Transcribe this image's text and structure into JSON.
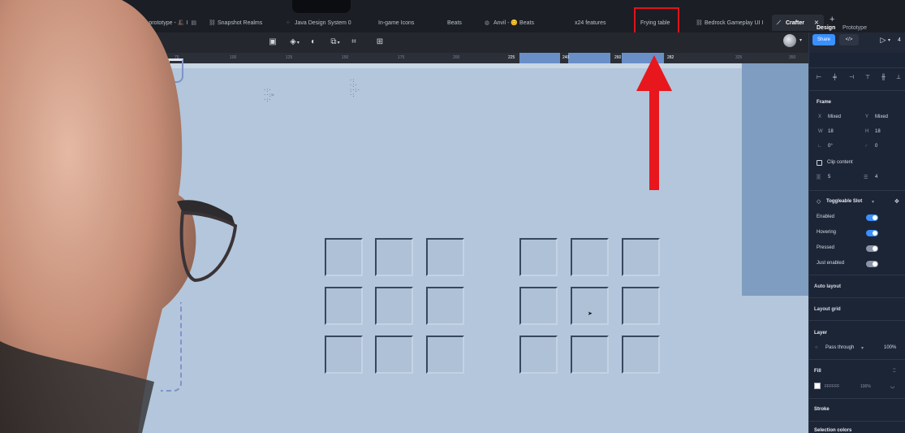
{
  "tabs": [
    {
      "label": "y5 prototype - 🎩 I",
      "icon": "file-icon"
    },
    {
      "label": "Snapshot Realms",
      "icon": "link-icon"
    },
    {
      "label": "Java Design System 0",
      "icon": "component-icon"
    },
    {
      "label": "In-game Icons",
      "icon": "file-icon"
    },
    {
      "label": "Beats",
      "icon": "file-icon"
    },
    {
      "label": "Anvil - 😊 Beats",
      "icon": "file-icon"
    },
    {
      "label": "x24 features",
      "icon": "file-icon"
    },
    {
      "label": "Frying table",
      "icon": "file-icon"
    },
    {
      "label": "Bedrock Gameplay UI I",
      "icon": "link-icon"
    },
    {
      "label": "Crafter",
      "icon": "figma-icon",
      "active": true
    }
  ],
  "ruler_labels": [
    "75",
    "100",
    "125",
    "150",
    "175",
    "200",
    "225",
    "240",
    "260",
    "282",
    "325",
    "350"
  ],
  "toolbar": {
    "share_label": "Share",
    "code_label": "</>",
    "play_label": "▷",
    "more_label": "4"
  },
  "panel": {
    "tabs": [
      "Design",
      "Prototype"
    ],
    "frame_label": "Frame",
    "x_label": "X",
    "x_value": "Mixed",
    "y_label": "Y",
    "y_value": "Mixed",
    "w_label": "W",
    "w_value": "18",
    "h_label": "H",
    "h_value": "18",
    "rotation_value": "0°",
    "radius_value": "0",
    "clip_content": "Clip content",
    "gap_h": "5",
    "gap_v": "4",
    "component_name": "Toggleable Slot",
    "properties": [
      {
        "label": "Enabled",
        "on": true
      },
      {
        "label": "Hovering",
        "on": true
      },
      {
        "label": "Pressed",
        "on": false
      },
      {
        "label": "Just enabled",
        "on": false
      }
    ],
    "auto_layout": "Auto layout",
    "layout_grid": "Layout grid",
    "layer_label": "Layer",
    "blend_mode": "Pass through",
    "layer_opacity": "100%",
    "fill_label": "Fill",
    "fill_hex": "FFFFFF",
    "fill_opacity": "100%",
    "stroke_label": "Stroke",
    "selection_colors": "Selection colors"
  },
  "colors": {
    "accent": "#3a90ff",
    "highlight": "#e0141b",
    "canvas": "#b3c6db"
  }
}
